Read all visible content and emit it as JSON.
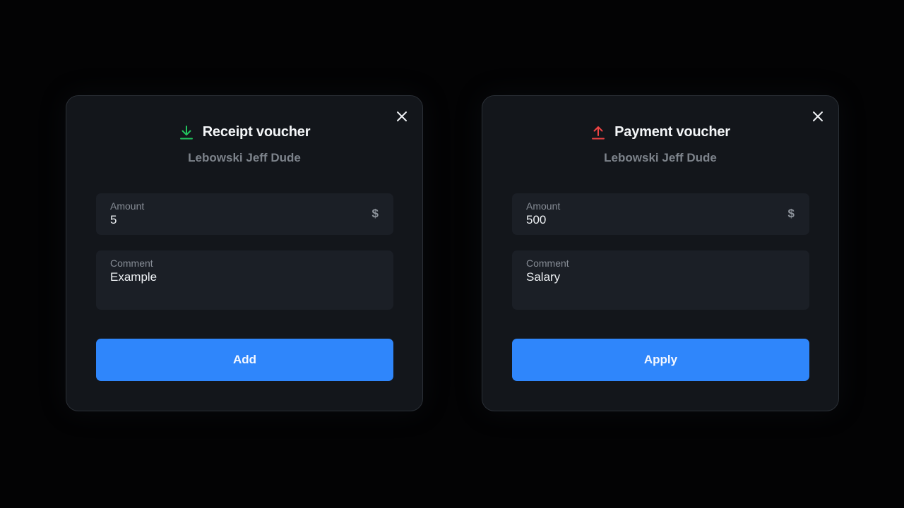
{
  "receipt_voucher": {
    "title": "Receipt voucher",
    "subtitle": "Lebowski Jeff Dude",
    "icon": "download-arrow-icon",
    "icon_color": "#22c55e",
    "amount": {
      "label": "Amount",
      "value": "5",
      "currency": "$"
    },
    "comment": {
      "label": "Comment",
      "value": "Example"
    },
    "button_label": "Add"
  },
  "payment_voucher": {
    "title": "Payment voucher",
    "subtitle": "Lebowski Jeff Dude",
    "icon": "upload-arrow-icon",
    "icon_color": "#ef4444",
    "amount": {
      "label": "Amount",
      "value": "500",
      "currency": "$"
    },
    "comment": {
      "label": "Comment",
      "value": "Salary"
    },
    "button_label": "Apply"
  },
  "colors": {
    "background": "#030304",
    "card": "#13161b",
    "field": "#1b1f26",
    "accent": "#2f86fb"
  }
}
